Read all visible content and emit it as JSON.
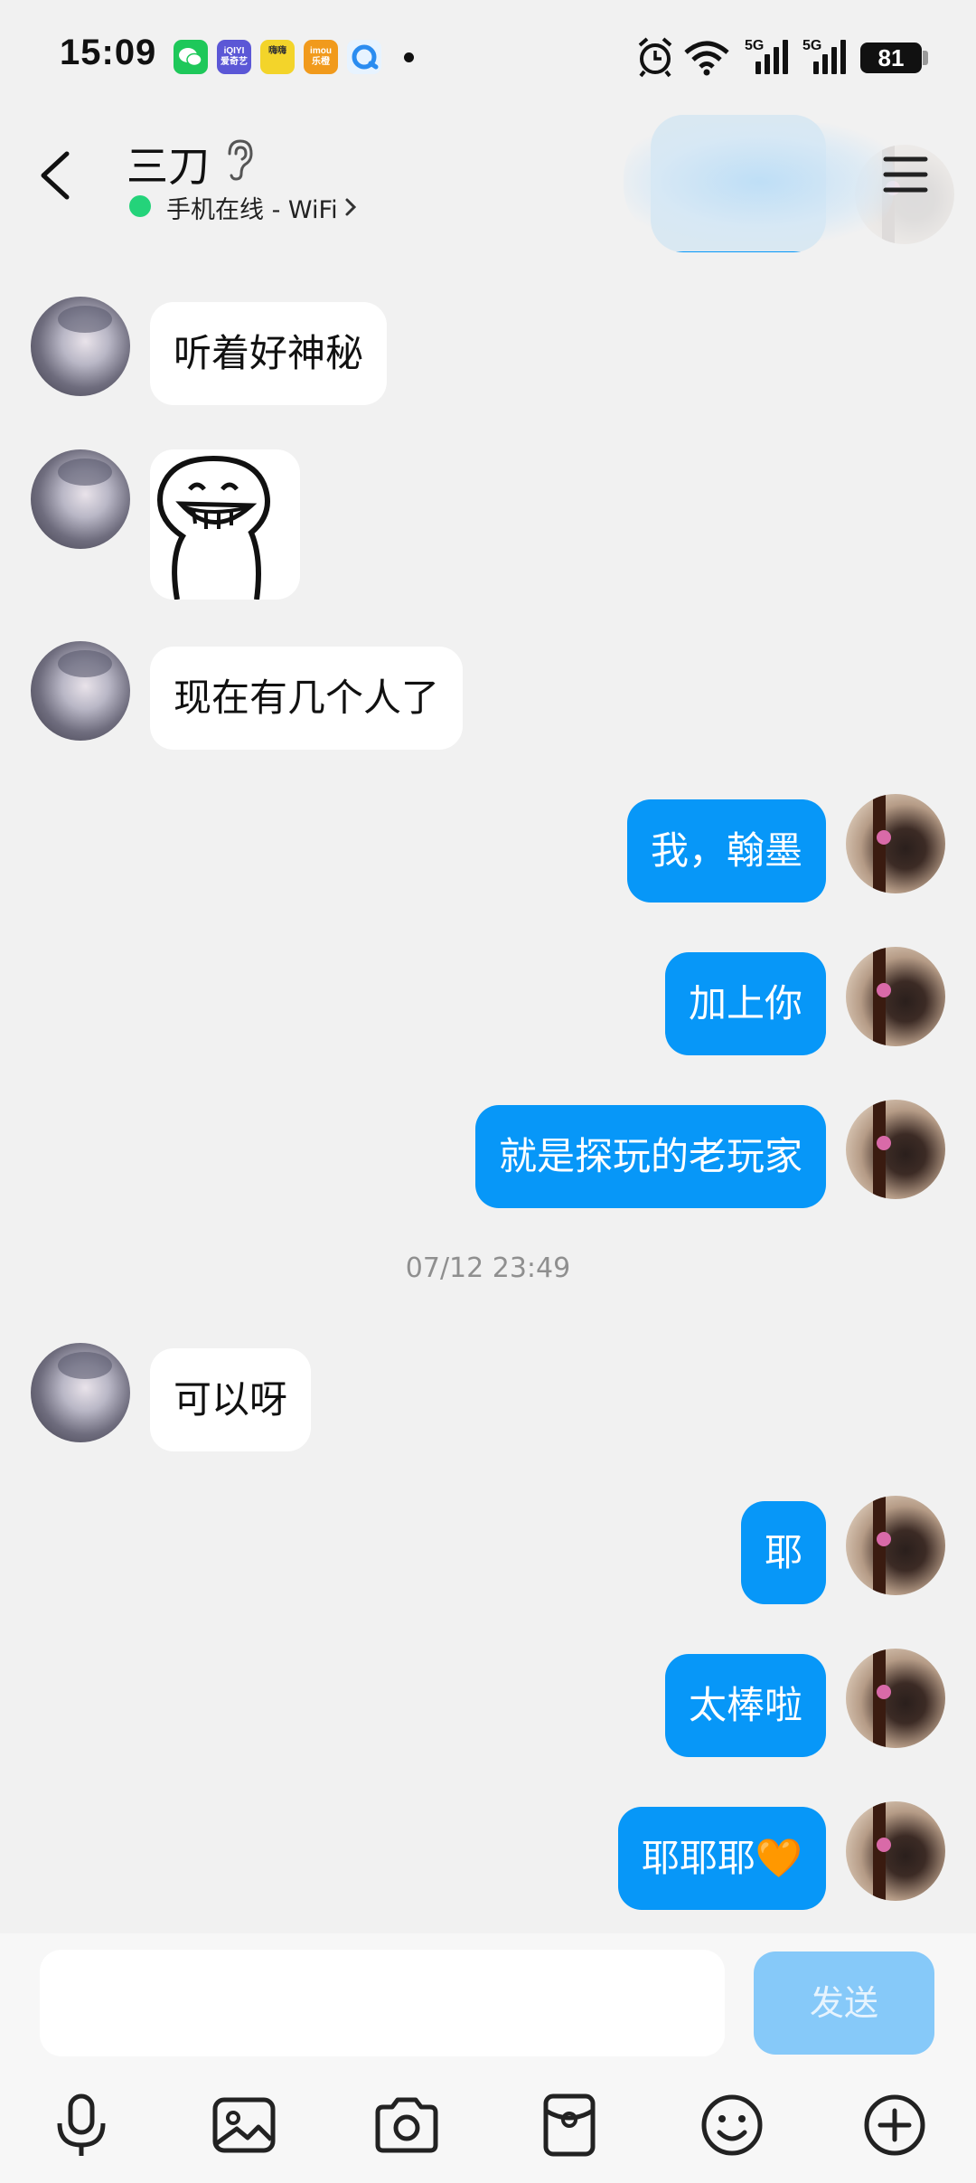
{
  "status_bar": {
    "time": "15:09",
    "battery": "81",
    "network_label_1": "5G",
    "network_label_2": "5G",
    "app_icons": [
      {
        "name": "wechat-icon",
        "color": "#1ec85a"
      },
      {
        "name": "iqiyi-icon",
        "color": "#5b57d6",
        "text": "iQIYI\n爱奇艺"
      },
      {
        "name": "haoshi-icon",
        "color": "#f3d42a",
        "text": "嗨嗨"
      },
      {
        "name": "imou-icon",
        "color": "#f19a1c",
        "text": "imou\n乐橙"
      },
      {
        "name": "qq-browser-icon",
        "color": "#e7f3ff"
      }
    ]
  },
  "header": {
    "title": "三刀",
    "subtitle": "手机在线 - WiFi",
    "online_color": "#24d37a"
  },
  "messages": [
    {
      "side": "in",
      "type": "text",
      "text": "听着好神秘"
    },
    {
      "side": "in",
      "type": "sticker",
      "sticker": "grinning-face-sticker"
    },
    {
      "side": "in",
      "type": "text",
      "text": "现在有几个人了"
    },
    {
      "side": "out",
      "type": "text",
      "text": "我，翰墨"
    },
    {
      "side": "out",
      "type": "text",
      "text": "加上你"
    },
    {
      "side": "out",
      "type": "text",
      "text": "就是探玩的老玩家"
    },
    {
      "side": "in",
      "type": "text",
      "text": "可以呀"
    },
    {
      "side": "out",
      "type": "text",
      "text": "耶"
    },
    {
      "side": "out",
      "type": "text",
      "text": "太棒啦"
    },
    {
      "side": "out",
      "type": "text",
      "text": "耶耶耶🧡"
    }
  ],
  "timestamp": "07/12 23:49",
  "input": {
    "value": "",
    "placeholder": "",
    "send_label": "发送"
  },
  "toolbar": [
    "microphone-icon",
    "image-icon",
    "camera-icon",
    "red-packet-icon",
    "emoji-icon",
    "plus-icon"
  ],
  "colors": {
    "background": "#f1f1f1",
    "outgoing_bubble": "#0797f8",
    "incoming_bubble": "#ffffff",
    "send_button_disabled": "#86c9f9"
  }
}
